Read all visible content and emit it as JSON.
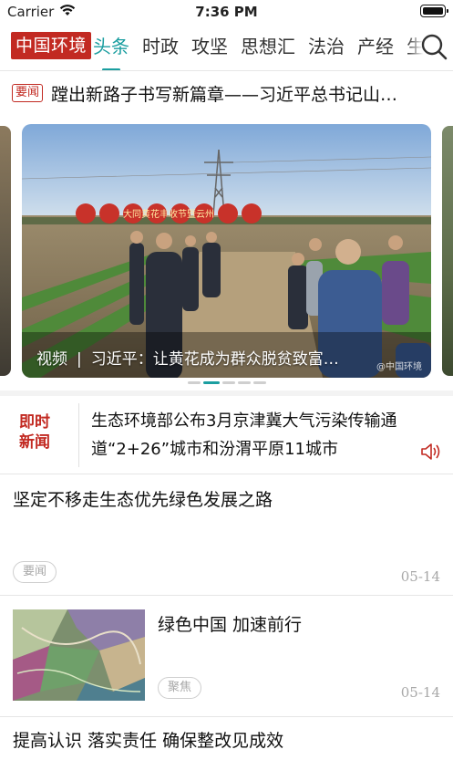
{
  "status_bar": {
    "carrier": "Carrier",
    "time": "7:36 PM"
  },
  "nav": {
    "brand": "中国环境",
    "tabs": [
      {
        "label": "头条",
        "active": true
      },
      {
        "label": "时政"
      },
      {
        "label": "攻坚"
      },
      {
        "label": "思想汇"
      },
      {
        "label": "法治"
      },
      {
        "label": "产经"
      },
      {
        "label": "生"
      }
    ],
    "accent_color": "#1b9ea0",
    "brand_color": "#c22a22"
  },
  "headline": {
    "tag": "要闻",
    "text": "蹚出新路子书写新篇章——习近平总书记山…"
  },
  "carousel": {
    "caption_type": "视频",
    "caption_sep": "|",
    "caption_text": "习近平：让黄花成为群众脱贫致富…",
    "sign_text": "大同黄花丰收节暨云州",
    "watermark": "@中国环境",
    "dot_count": 5,
    "active_dot": 1
  },
  "flash_news": {
    "label_line1": "即时",
    "label_line2": "新闻",
    "text": "生态环境部公布3月京津冀大气污染传输通道“2+26”城市和汾渭平原11城市"
  },
  "articles": [
    {
      "title": "坚定不移走生态优先绿色发展之路",
      "tag": "要闻",
      "date": "05-14"
    },
    {
      "title": "绿色中国  加速前行",
      "tag": "聚焦",
      "date": "05-14"
    },
    {
      "title": "提高认识  落实责任  确保整改见成效"
    }
  ]
}
